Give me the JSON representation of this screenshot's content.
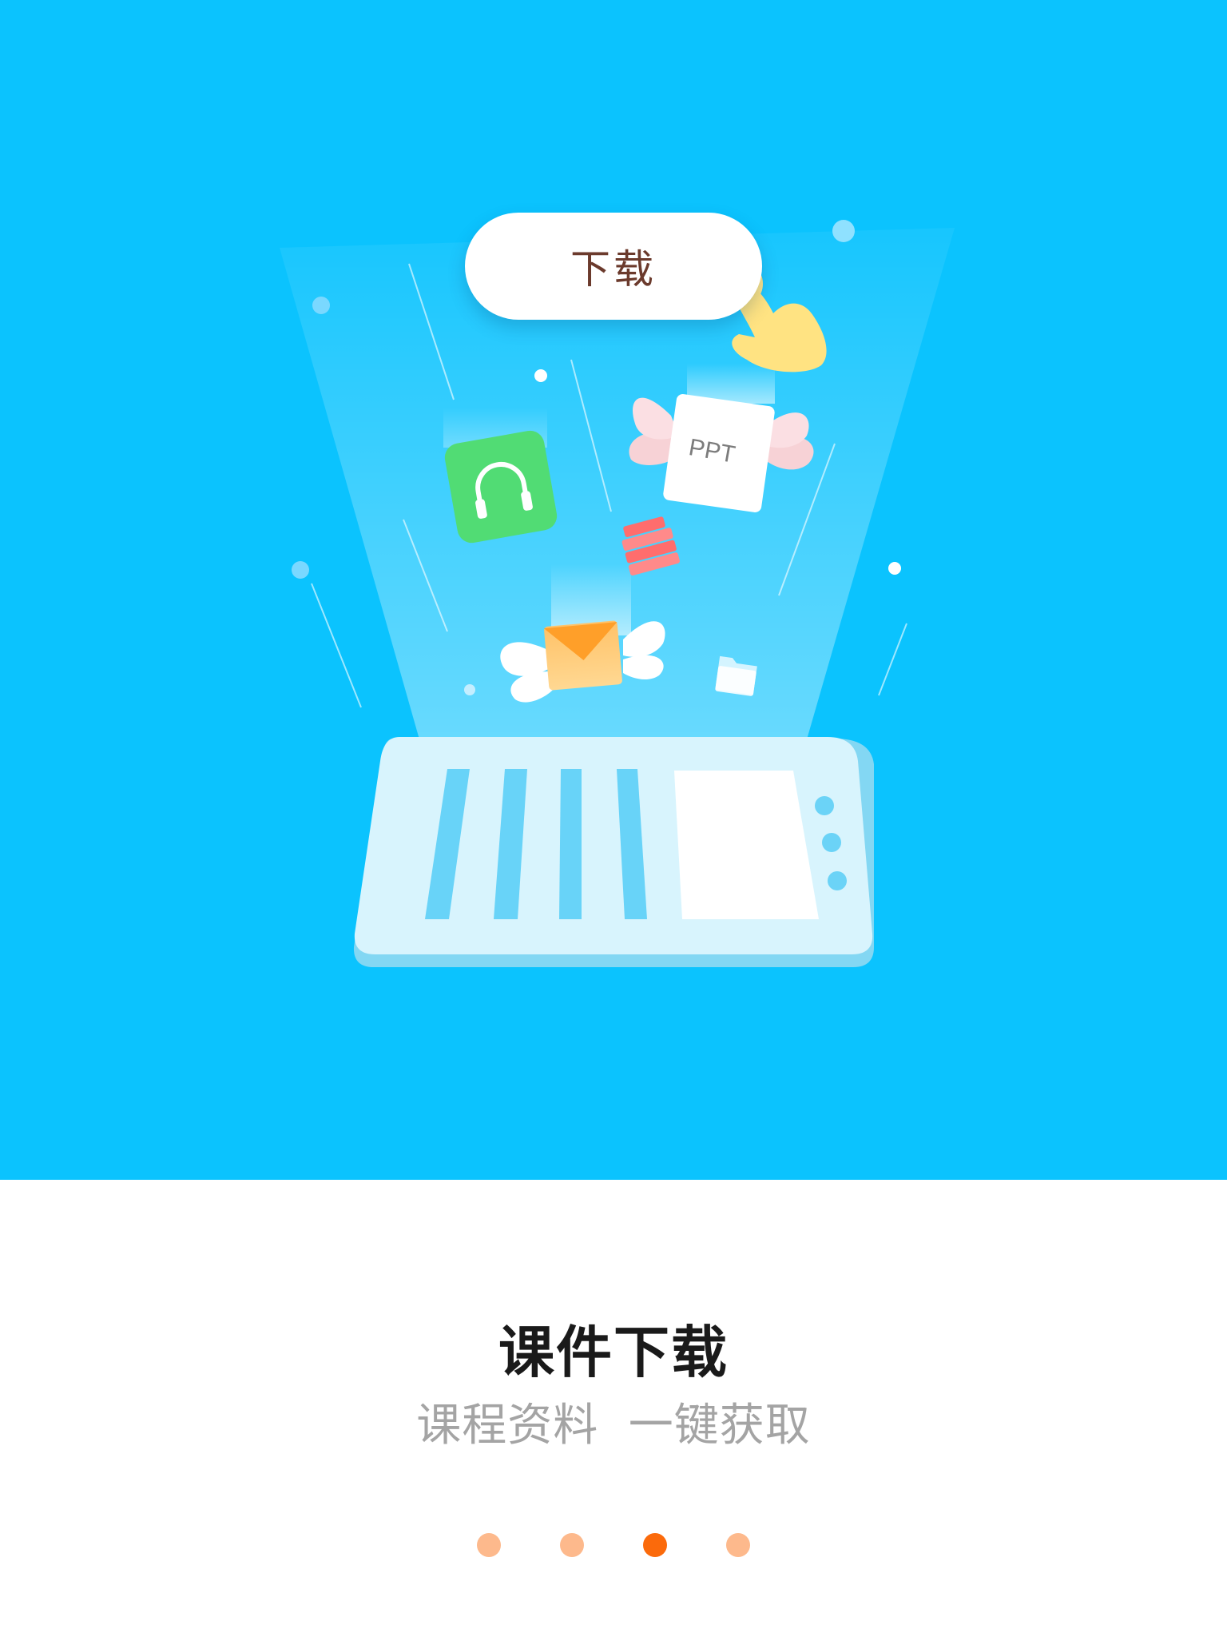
{
  "hero": {
    "download_button_label": "下载",
    "ppt_card_label": "PPT",
    "background_color": "#0bc3fe"
  },
  "page": {
    "title": "课件下载",
    "subtitle": "课程资料  一键获取"
  },
  "pagination": {
    "total": 4,
    "active_index": 2,
    "active_color": "#fb6a0b",
    "inactive_color": "#fdb98c"
  },
  "icons": [
    "headphones-icon",
    "ppt-document-icon",
    "books-icon",
    "envelope-icon",
    "folder-icon",
    "pointing-hand-icon",
    "tablet-device-icon"
  ]
}
